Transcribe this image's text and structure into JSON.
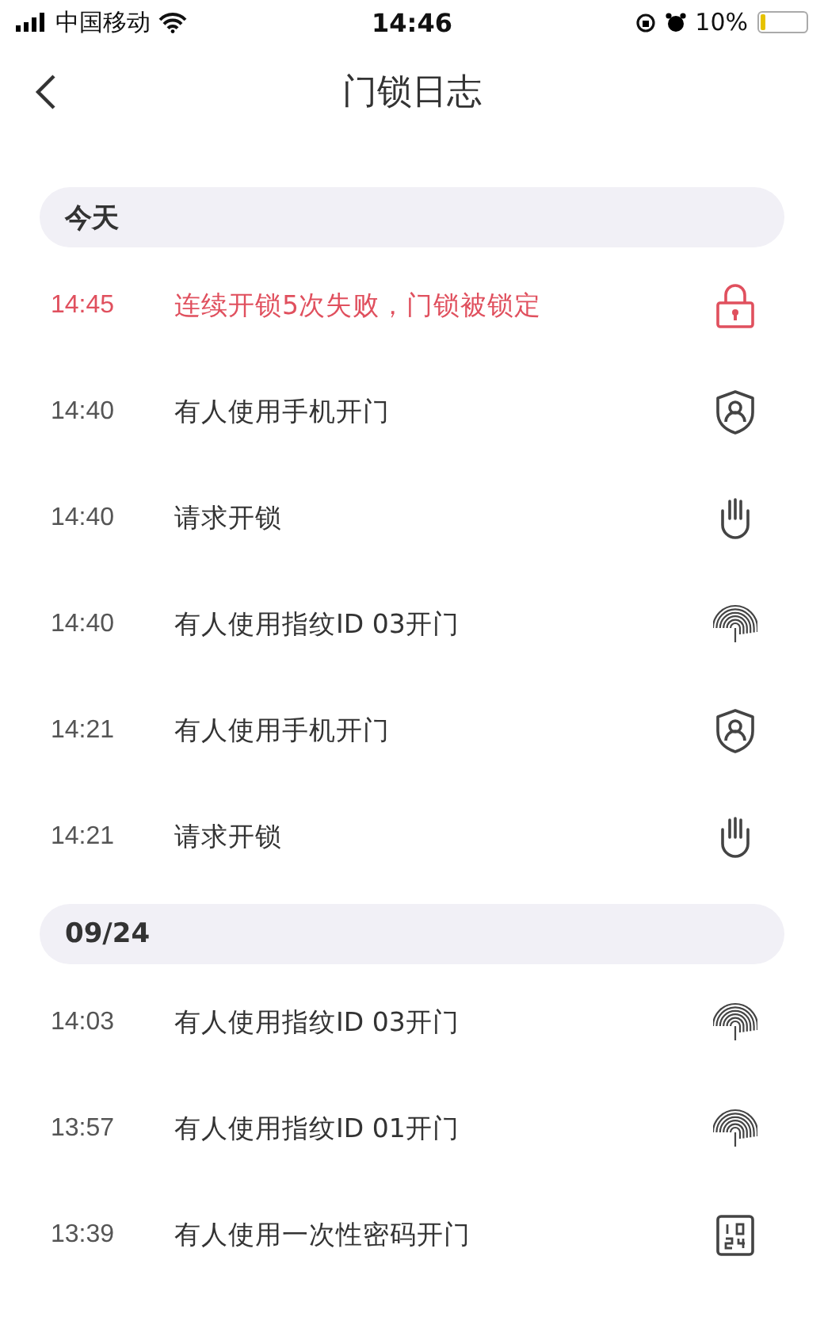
{
  "status_bar": {
    "carrier": "中国移动",
    "time": "14:46",
    "battery": "10%"
  },
  "nav": {
    "title": "门锁日志"
  },
  "sections": [
    {
      "date": "今天",
      "entries": [
        {
          "time": "14:45",
          "text": "连续开锁5次失败，门锁被锁定",
          "alert": true,
          "kind": "lock"
        },
        {
          "time": "14:40",
          "text": "有人使用手机开门",
          "alert": false,
          "kind": "phone"
        },
        {
          "time": "14:40",
          "text": "请求开锁",
          "alert": false,
          "kind": "hand"
        },
        {
          "time": "14:40",
          "text": "有人使用指纹ID 03开门",
          "alert": false,
          "kind": "fingerprint"
        },
        {
          "time": "14:21",
          "text": "有人使用手机开门",
          "alert": false,
          "kind": "phone"
        },
        {
          "time": "14:21",
          "text": "请求开锁",
          "alert": false,
          "kind": "hand"
        }
      ]
    },
    {
      "date": "09/24",
      "entries": [
        {
          "time": "14:03",
          "text": "有人使用指纹ID 03开门",
          "alert": false,
          "kind": "fingerprint"
        },
        {
          "time": "13:57",
          "text": "有人使用指纹ID 01开门",
          "alert": false,
          "kind": "fingerprint"
        },
        {
          "time": "13:39",
          "text": "有人使用一次性密码开门",
          "alert": false,
          "kind": "code"
        }
      ]
    }
  ]
}
